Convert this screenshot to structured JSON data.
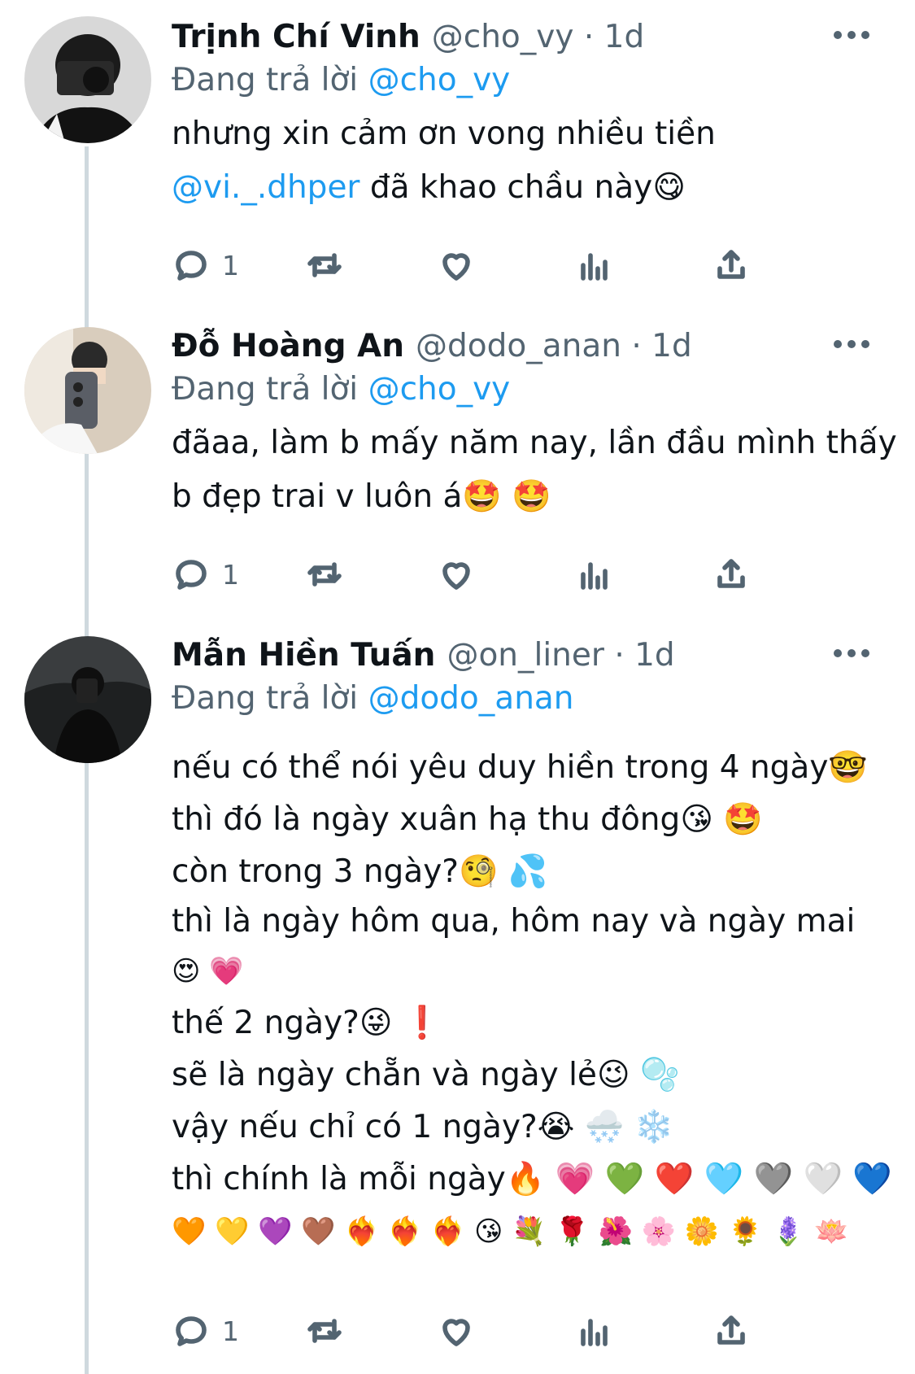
{
  "tweets": [
    {
      "name": "Trịnh Chí Vinh",
      "handle_time": "@cho_vy · 1d",
      "reply_prefix": "Đang trả lời",
      "reply_to": "@cho_vy",
      "lines": [
        {
          "text": "nhưng xin cảm ơn vong nhiều tiền"
        },
        {
          "mention": "@vi._.dhper",
          "text": " đã khao chầu này😋"
        }
      ],
      "reply_count": "1"
    },
    {
      "name": "Đỗ Hoàng An",
      "handle_time": "@dodo_anan · 1d",
      "reply_prefix": "Đang trả lời",
      "reply_to": "@cho_vy",
      "lines": [
        {
          "text": "đãaa, làm b mấy năm nay, lần đầu mình thấy"
        },
        {
          "text": "b đẹp trai v luôn á🤩 🤩"
        }
      ],
      "reply_count": "1"
    },
    {
      "name": "Mẫn Hiền Tuấn",
      "handle_time": "@on_liner · 1d",
      "reply_prefix": "Đang trả lời",
      "reply_to": "@dodo_anan",
      "lines": [
        {
          "text": "nếu có thể nói yêu duy hiền trong 4 ngày🤓"
        },
        {
          "text": "thì đó là ngày xuân hạ thu đông😘 🤩"
        },
        {
          "text": "còn trong 3 ngày?🧐 💦"
        },
        {
          "text": "thì là ngày hôm qua, hôm nay và ngày mai"
        },
        {
          "text": "😍 💗"
        },
        {
          "text": "thế 2 ngày?😜 ❗"
        },
        {
          "text": "sẽ là ngày chẵn và ngày lẻ😉 🫧"
        },
        {
          "text": "vậy nếu chỉ có 1 ngày?😭 🌨️ ❄️"
        },
        {
          "text": "thì chính là mỗi ngày🔥 💗 💚 ❤️ 🩵 🩶 🤍 💙"
        },
        {
          "text": "🧡 💛 💜 🤎 ❤️‍🔥 ❤️‍🔥 ❤️‍🔥 😘 💐 🌹 🌺 🌸 🌼 🌻 🪻 🪷"
        }
      ],
      "reply_count": "1"
    }
  ],
  "colors": {
    "link": "#1d9bf0",
    "secondary": "#536471",
    "text": "#0f1419",
    "thread_line": "#cfd9de"
  },
  "icons": [
    "reply-icon",
    "retweet-icon",
    "like-icon",
    "views-icon",
    "share-icon",
    "more-icon"
  ]
}
